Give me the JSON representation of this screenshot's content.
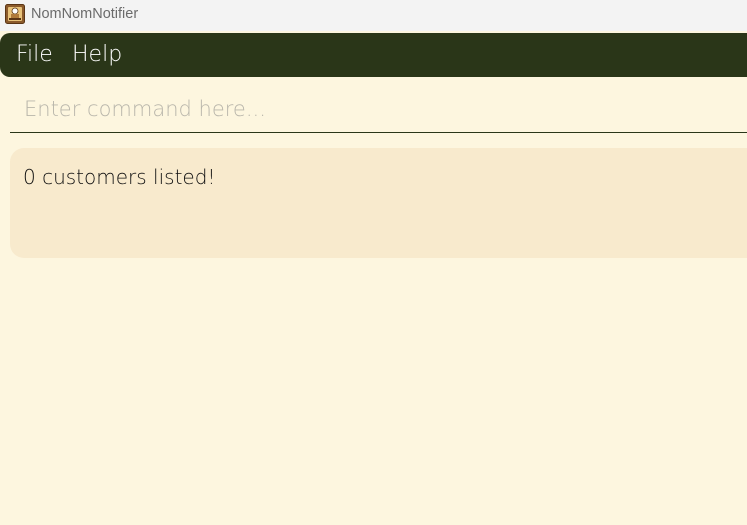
{
  "window": {
    "title": "NomNomNotifier",
    "icon": "chef-app-icon"
  },
  "menu": {
    "items": [
      {
        "label": "File"
      },
      {
        "label": "Help"
      }
    ]
  },
  "command": {
    "placeholder": "Enter command here...",
    "value": ""
  },
  "result": {
    "message": "0 customers listed!"
  },
  "colors": {
    "background": "#fdf6df",
    "menubar": "#2a3618",
    "result_panel": "#f8eacd",
    "titlebar": "#f3f3f3"
  }
}
